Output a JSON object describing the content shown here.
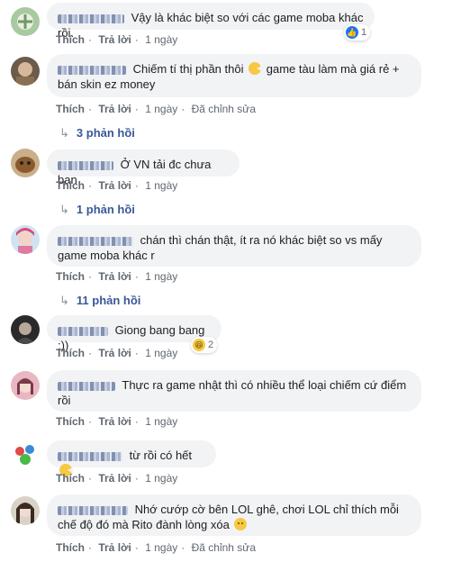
{
  "colors": {
    "bubble": "#f2f3f5",
    "link": "#385898",
    "meta": "#606770",
    "like": "#1877f2"
  },
  "actions": {
    "like": "Thích",
    "reply": "Trả lời",
    "edited": "Đã chỉnh sửa"
  },
  "comments": [
    {
      "text": "Vậy là khác biệt so với các game moba khác rồi.",
      "time": "1 ngày",
      "reaction": {
        "icon": "like-icon",
        "count": "1"
      }
    },
    {
      "text_a": "Chiếm tí thị phần thôi",
      "emoji": "pacman-emoji",
      "text_b": "game tàu làm mà giá rẻ + bán skin ez money",
      "time": "1 ngày",
      "edited": true,
      "replies": "3 phản hồi"
    },
    {
      "text": "Ở VN tải đc chưa bạn",
      "time": "1 ngày",
      "replies": "1 phản hồi"
    },
    {
      "text": "chán thì chán thật, ít ra nó khác biệt so vs mấy game moba khác r",
      "time": "1 ngày",
      "replies": "11 phản hồi"
    },
    {
      "text": "Giong bang bang :))",
      "time": "1 ngày",
      "reaction": {
        "icon": "haha-icon",
        "count": "2"
      }
    },
    {
      "text": "Thực ra game nhật thì có nhiều thể loại chiếm cứ điểm rồi",
      "time": "1 ngày"
    },
    {
      "text": "từ rồi có hết",
      "emoji": "pacman-emoji",
      "time": "1 ngày"
    },
    {
      "text": "Nhớ cướp cờ bên LOL ghê, chơi LOL chỉ thích mỗi chế độ đó mà Rito đành lòng xóa",
      "emoji": "sad-emoji",
      "time": "1 ngày",
      "edited": true
    }
  ]
}
